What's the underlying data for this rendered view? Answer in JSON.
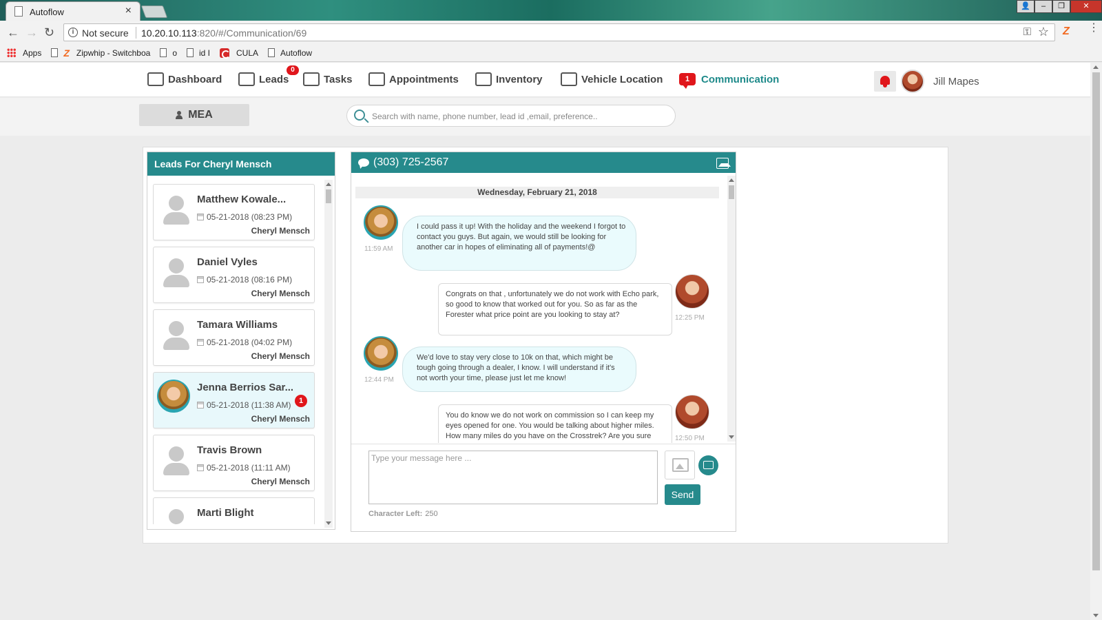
{
  "browser": {
    "tab_title": "Autoflow",
    "not_secure": "Not secure",
    "url_host": "10.20.10.113",
    "url_rest": ":820/#/Communication/69",
    "bookmarks": [
      "Apps",
      "Zipwhip - Switchboa",
      "o",
      "id I",
      "CULA",
      "Autoflow"
    ]
  },
  "nav": {
    "dashboard": "Dashboard",
    "leads": "Leads",
    "leads_badge": "0",
    "tasks": "Tasks",
    "appointments": "Appointments",
    "inventory": "Inventory",
    "vehicle_location": "Vehicle Location",
    "communication": "Communication",
    "communication_badge": "1",
    "user_name": "Jill Mapes"
  },
  "subbar": {
    "mea_label": "MEA",
    "search_placeholder": "Search with name, phone number, lead id ,email, preference.."
  },
  "leads_panel": {
    "title": "Leads For Cheryl Mensch",
    "leads": [
      {
        "name": "Matthew Kowale...",
        "date": "05-21-2018 (08:23 PM)",
        "owner": "Cheryl Mensch"
      },
      {
        "name": "Daniel Vyles",
        "date": "05-21-2018 (08:16 PM)",
        "owner": "Cheryl Mensch"
      },
      {
        "name": "Tamara Williams",
        "date": "05-21-2018 (04:02 PM)",
        "owner": "Cheryl Mensch"
      },
      {
        "name": "Jenna Berrios Sar...",
        "date": "05-21-2018 (11:38 AM)",
        "owner": "Cheryl Mensch",
        "badge": "1"
      },
      {
        "name": "Travis Brown",
        "date": "05-21-2018 (11:11 AM)",
        "owner": "Cheryl Mensch"
      },
      {
        "name": "Marti Blight",
        "date": "",
        "owner": ""
      }
    ]
  },
  "chat": {
    "phone": "(303) 725-2567",
    "date_header": "Wednesday, February 21, 2018",
    "messages": [
      {
        "time": "11:59 AM",
        "text": "I could pass it up! With the holiday and the weekend I forgot to contact you guys. But again, we would still be looking for another car in hopes of eliminating all of payments!@"
      },
      {
        "time": "12:25 PM",
        "text": "Congrats on that , unfortunately we do not work with Echo park, so good to know that worked out for you. So as far as the Forester what price point are you looking to stay at?"
      },
      {
        "time": "12:44 PM",
        "text": "We'd love to stay very close to 10k on that, which might be tough going through a dealer, I know. I will understand if it's not worth your time, please just let me know!"
      },
      {
        "time": "12:50 PM",
        "text": "You do know we do not work on commission so I can keep my eyes opened for one. You would be talking about higher miles. How many miles do you have on the Crosstrek? Are you sure"
      }
    ],
    "input_placeholder": "Type your message here ...",
    "send_label": "Send",
    "char_left_label": "Character Left:",
    "char_left_value": "250"
  }
}
